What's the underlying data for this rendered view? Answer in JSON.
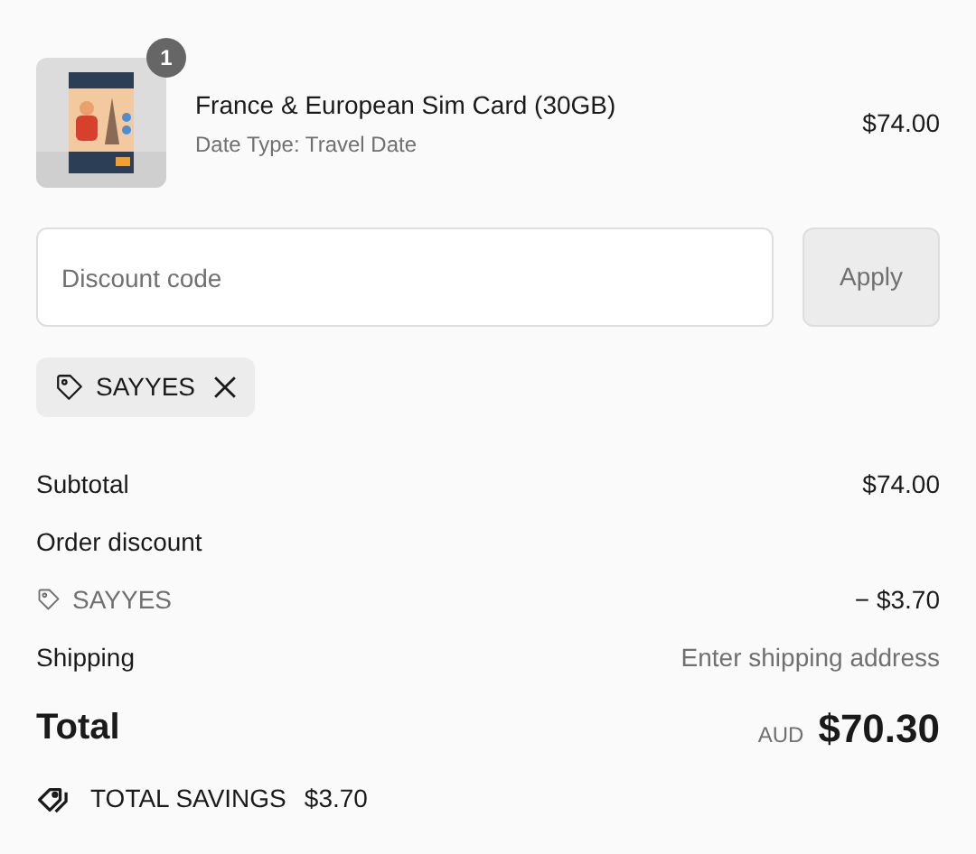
{
  "line_items": [
    {
      "kind": "picture",
      "quantity": "1",
      "title": "France & European Sim Card (30GB)",
      "subtitle": "Date Type: Travel Date",
      "price": "$74.00"
    }
  ],
  "discount": {
    "placeholder": "Discount code",
    "button": "Apply",
    "applied_codes": [
      "SAYYES"
    ]
  },
  "summary": [
    {
      "kind": "line",
      "label": "Subtotal",
      "value": "$74.00"
    },
    {
      "kind": "heading",
      "label": "Order discount"
    },
    {
      "kind": "code",
      "label": "SAYYES",
      "value": "− $3.70"
    },
    {
      "kind": "muted",
      "label": "Shipping",
      "value": "Enter shipping address"
    }
  ],
  "total": {
    "label": "Total",
    "currency": "AUD",
    "amount": "$70.30"
  },
  "savings": {
    "label": "TOTAL SAVINGS",
    "amount": "$3.70"
  }
}
